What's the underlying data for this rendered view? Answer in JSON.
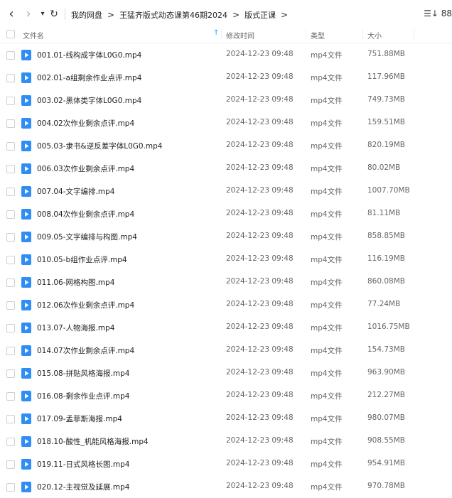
{
  "nav": {
    "back": "‹",
    "forward": "›",
    "dropdown": "▾",
    "refresh": "↻"
  },
  "breadcrumb": {
    "items": [
      "我的网盘",
      "王猛齐版式动态课第46期2024",
      "版式正课"
    ],
    "separator": ">"
  },
  "view_icons": "☰↓ 88",
  "columns": {
    "name": "文件名",
    "modified": "修改时间",
    "type": "类型",
    "size": "大小"
  },
  "files": [
    {
      "name": "001.01-线构成字体L0G0.mp4",
      "date": "2024-12-23 09:48",
      "type": "mp4文件",
      "size": "751.88MB"
    },
    {
      "name": "002.01-a组剩余作业点评.mp4",
      "date": "2024-12-23 09:48",
      "type": "mp4文件",
      "size": "117.96MB"
    },
    {
      "name": "003.02-黑体类字体L0G0.mp4",
      "date": "2024-12-23 09:48",
      "type": "mp4文件",
      "size": "749.73MB"
    },
    {
      "name": "004.02次作业剩余点评.mp4",
      "date": "2024-12-23 09:48",
      "type": "mp4文件",
      "size": "159.51MB"
    },
    {
      "name": "005.03-隶书&逆反差字体L0G0.mp4",
      "date": "2024-12-23 09:48",
      "type": "mp4文件",
      "size": "820.19MB"
    },
    {
      "name": "006.03次作业剩余点评.mp4",
      "date": "2024-12-23 09:48",
      "type": "mp4文件",
      "size": "80.02MB"
    },
    {
      "name": "007.04-文字编排.mp4",
      "date": "2024-12-23 09:48",
      "type": "mp4文件",
      "size": "1007.70MB"
    },
    {
      "name": "008.04次作业剩余点评.mp4",
      "date": "2024-12-23 09:48",
      "type": "mp4文件",
      "size": "81.11MB"
    },
    {
      "name": "009.05-文字编排与构图.mp4",
      "date": "2024-12-23 09:48",
      "type": "mp4文件",
      "size": "858.85MB"
    },
    {
      "name": "010.05-b组作业点评.mp4",
      "date": "2024-12-23 09:48",
      "type": "mp4文件",
      "size": "116.19MB"
    },
    {
      "name": "011.06-网格构图.mp4",
      "date": "2024-12-23 09:48",
      "type": "mp4文件",
      "size": "860.08MB"
    },
    {
      "name": "012.06次作业剩余点评.mp4",
      "date": "2024-12-23 09:48",
      "type": "mp4文件",
      "size": "77.24MB"
    },
    {
      "name": "013.07-人物海报.mp4",
      "date": "2024-12-23 09:48",
      "type": "mp4文件",
      "size": "1016.75MB"
    },
    {
      "name": "014.07次作业剩余点评.mp4",
      "date": "2024-12-23 09:48",
      "type": "mp4文件",
      "size": "154.73MB"
    },
    {
      "name": "015.08-拼贴风格海报.mp4",
      "date": "2024-12-23 09:48",
      "type": "mp4文件",
      "size": "963.90MB"
    },
    {
      "name": "016.08-剩余作业点评.mp4",
      "date": "2024-12-23 09:48",
      "type": "mp4文件",
      "size": "212.27MB"
    },
    {
      "name": "017.09-孟菲斯海报.mp4",
      "date": "2024-12-23 09:48",
      "type": "mp4文件",
      "size": "980.07MB"
    },
    {
      "name": "018.10-酸性_机能风格海报.mp4",
      "date": "2024-12-23 09:48",
      "type": "mp4文件",
      "size": "908.55MB"
    },
    {
      "name": "019.11-日式风格长图.mp4",
      "date": "2024-12-23 09:48",
      "type": "mp4文件",
      "size": "954.91MB"
    },
    {
      "name": "020.12-主视觉及延展.mp4",
      "date": "2024-12-23 09:48",
      "type": "mp4文件",
      "size": "970.78MB"
    }
  ],
  "colors": {
    "file_icon": "#2f8df6",
    "sort_arrow": "#06a7ff"
  }
}
